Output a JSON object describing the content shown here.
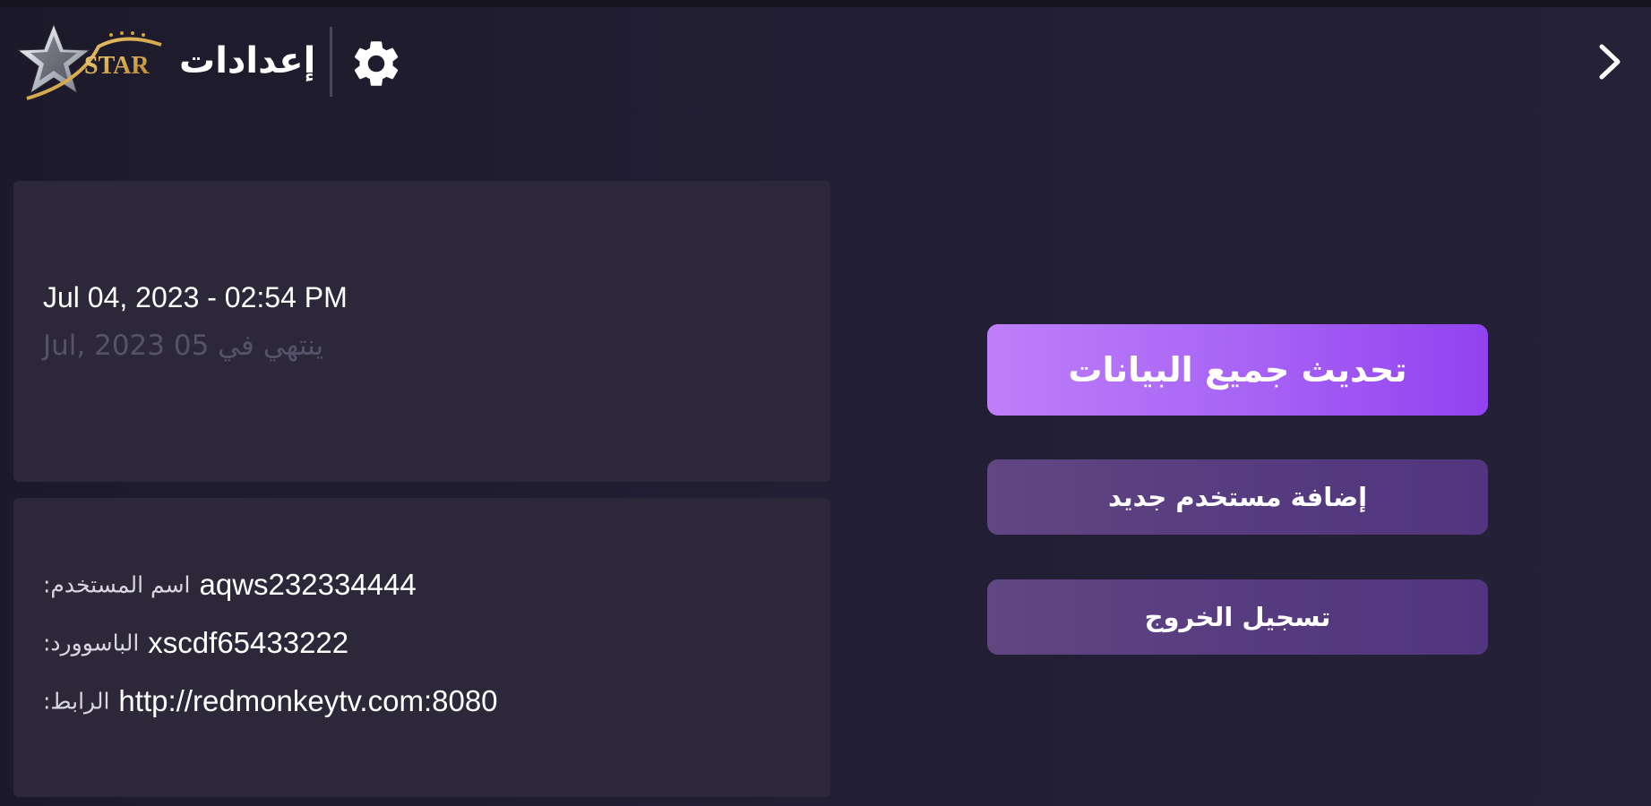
{
  "header": {
    "logo_text": "STAR",
    "title": "إعدادات",
    "back_icon": "chevron-right-icon",
    "settings_icon": "gear-icon"
  },
  "subscription": {
    "date": "Jul 04, 2023 - 02:54 PM",
    "expiry": "ينتهي في 05 Jul, 2023"
  },
  "account": {
    "username_label": "اسم المستخدم:",
    "username": "aqws232334444",
    "password_label": "الباسوورد:",
    "password": "xscdf65433222",
    "url_label": "الرابط:",
    "url": "http://redmonkeytv.com:8080"
  },
  "actions": {
    "refresh_label": "تحديث جميع البيانات",
    "add_user_label": "إضافة مستخدم جديد",
    "logout_label": "تسجيل الخروج"
  },
  "colors": {
    "background": "#211d31",
    "panel": "#2c2839",
    "primary_button_start": "#bf7ff9",
    "primary_button_end": "#9242f0",
    "secondary_button": "#553a7f",
    "logo_gold": "#d4a239"
  }
}
